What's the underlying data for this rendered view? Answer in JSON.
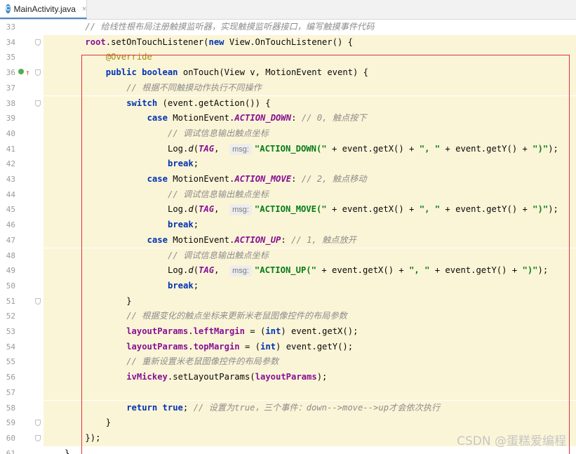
{
  "tab": {
    "icon": "class-icon",
    "icon_letter": "C",
    "label": "MainActivity.java",
    "close": "×"
  },
  "watermark": "CSDN @蛋糕爱编程",
  "lines": [
    {
      "n": "33",
      "indent": 4,
      "segs": [
        {
          "c": "cm",
          "t": "// 给线性根布局注册触摸监听器，实现触摸监听器接口，编写触摸事件代码"
        }
      ]
    },
    {
      "n": "34",
      "indent": 4,
      "segs": [
        {
          "c": "fld",
          "t": "root"
        },
        {
          "c": "",
          "t": ".setOnTouchListener("
        },
        {
          "c": "kw",
          "t": "new"
        },
        {
          "c": "",
          "t": " View.OnTouchListener() {"
        }
      ]
    },
    {
      "n": "35",
      "indent": 8,
      "segs": [
        {
          "c": "an",
          "t": "@Override"
        }
      ]
    },
    {
      "n": "36",
      "indent": 8,
      "segs": [
        {
          "c": "kw",
          "t": "public boolean"
        },
        {
          "c": "",
          "t": " onTouch(View v, MotionEvent event) {"
        }
      ]
    },
    {
      "n": "37",
      "indent": 12,
      "segs": [
        {
          "c": "cm",
          "t": "// 根据不同触摸动作执行不同操作"
        }
      ]
    },
    {
      "n": "38",
      "indent": 12,
      "segs": [
        {
          "c": "kw",
          "t": "switch"
        },
        {
          "c": "",
          "t": " (event.getAction()) {"
        }
      ]
    },
    {
      "n": "39",
      "indent": 16,
      "segs": [
        {
          "c": "kw",
          "t": "case"
        },
        {
          "c": "",
          "t": " MotionEvent."
        },
        {
          "c": "sfld",
          "t": "ACTION_DOWN"
        },
        {
          "c": "",
          "t": ": "
        },
        {
          "c": "cm",
          "t": "// 0, 触点按下"
        }
      ]
    },
    {
      "n": "40",
      "indent": 20,
      "segs": [
        {
          "c": "cm",
          "t": "// 调试信息输出触点坐标"
        }
      ]
    },
    {
      "n": "41",
      "indent": 20,
      "segs": [
        {
          "c": "",
          "t": "Log."
        },
        {
          "c": "mth",
          "t": "d"
        },
        {
          "c": "",
          "t": "("
        },
        {
          "c": "sfld",
          "t": "TAG"
        },
        {
          "c": "",
          "t": ",  "
        },
        {
          "c": "hint",
          "t": "msg:"
        },
        {
          "c": "st",
          "t": "\"ACTION_DOWN(\""
        },
        {
          "c": "",
          "t": " + event.getX() + "
        },
        {
          "c": "st",
          "t": "\", \""
        },
        {
          "c": "",
          "t": " + event.getY() + "
        },
        {
          "c": "st",
          "t": "\")\""
        },
        {
          "c": "",
          "t": ");"
        }
      ]
    },
    {
      "n": "42",
      "indent": 20,
      "segs": [
        {
          "c": "kw",
          "t": "break"
        },
        {
          "c": "",
          "t": ";"
        }
      ]
    },
    {
      "n": "43",
      "indent": 16,
      "segs": [
        {
          "c": "kw",
          "t": "case"
        },
        {
          "c": "",
          "t": " MotionEvent."
        },
        {
          "c": "sfld",
          "t": "ACTION_MOVE"
        },
        {
          "c": "",
          "t": ": "
        },
        {
          "c": "cm",
          "t": "// 2, 触点移动"
        }
      ]
    },
    {
      "n": "44",
      "indent": 20,
      "segs": [
        {
          "c": "cm",
          "t": "// 调试信息输出触点坐标"
        }
      ]
    },
    {
      "n": "45",
      "indent": 20,
      "segs": [
        {
          "c": "",
          "t": "Log."
        },
        {
          "c": "mth",
          "t": "d"
        },
        {
          "c": "",
          "t": "("
        },
        {
          "c": "sfld",
          "t": "TAG"
        },
        {
          "c": "",
          "t": ",  "
        },
        {
          "c": "hint",
          "t": "msg:"
        },
        {
          "c": "st",
          "t": "\"ACTION_MOVE(\""
        },
        {
          "c": "",
          "t": " + event.getX() + "
        },
        {
          "c": "st",
          "t": "\", \""
        },
        {
          "c": "",
          "t": " + event.getY() + "
        },
        {
          "c": "st",
          "t": "\")\""
        },
        {
          "c": "",
          "t": ");"
        }
      ]
    },
    {
      "n": "46",
      "indent": 20,
      "segs": [
        {
          "c": "kw",
          "t": "break"
        },
        {
          "c": "",
          "t": ";"
        }
      ]
    },
    {
      "n": "47",
      "indent": 16,
      "segs": [
        {
          "c": "kw",
          "t": "case"
        },
        {
          "c": "",
          "t": " MotionEvent."
        },
        {
          "c": "sfld",
          "t": "ACTION_UP"
        },
        {
          "c": "",
          "t": ": "
        },
        {
          "c": "cm",
          "t": "// 1, 触点放开"
        }
      ]
    },
    {
      "n": "48",
      "indent": 20,
      "segs": [
        {
          "c": "cm",
          "t": "// 调试信息输出触点坐标"
        }
      ]
    },
    {
      "n": "49",
      "indent": 20,
      "segs": [
        {
          "c": "",
          "t": "Log."
        },
        {
          "c": "mth",
          "t": "d"
        },
        {
          "c": "",
          "t": "("
        },
        {
          "c": "sfld",
          "t": "TAG"
        },
        {
          "c": "",
          "t": ",  "
        },
        {
          "c": "hint",
          "t": "msg:"
        },
        {
          "c": "st",
          "t": "\"ACTION_UP(\""
        },
        {
          "c": "",
          "t": " + event.getX() + "
        },
        {
          "c": "st",
          "t": "\", \""
        },
        {
          "c": "",
          "t": " + event.getY() + "
        },
        {
          "c": "st",
          "t": "\")\""
        },
        {
          "c": "",
          "t": ");"
        }
      ]
    },
    {
      "n": "50",
      "indent": 20,
      "segs": [
        {
          "c": "kw",
          "t": "break"
        },
        {
          "c": "",
          "t": ";"
        }
      ]
    },
    {
      "n": "51",
      "indent": 12,
      "segs": [
        {
          "c": "",
          "t": "}"
        }
      ]
    },
    {
      "n": "52",
      "indent": 12,
      "segs": [
        {
          "c": "cm",
          "t": "// 根据变化的触点坐标来更新米老鼠图像控件的布局参数"
        }
      ]
    },
    {
      "n": "53",
      "indent": 12,
      "segs": [
        {
          "c": "fld",
          "t": "layoutParams"
        },
        {
          "c": "",
          "t": "."
        },
        {
          "c": "fld",
          "t": "leftMargin"
        },
        {
          "c": "",
          "t": " = ("
        },
        {
          "c": "kw",
          "t": "int"
        },
        {
          "c": "",
          "t": ") event.getX();"
        }
      ]
    },
    {
      "n": "54",
      "indent": 12,
      "segs": [
        {
          "c": "fld",
          "t": "layoutParams"
        },
        {
          "c": "",
          "t": "."
        },
        {
          "c": "fld",
          "t": "topMargin"
        },
        {
          "c": "",
          "t": " = ("
        },
        {
          "c": "kw",
          "t": "int"
        },
        {
          "c": "",
          "t": ") event.getY();"
        }
      ]
    },
    {
      "n": "55",
      "indent": 12,
      "segs": [
        {
          "c": "cm",
          "t": "// 重新设置米老鼠图像控件的布局参数"
        }
      ]
    },
    {
      "n": "56",
      "indent": 12,
      "segs": [
        {
          "c": "fld",
          "t": "ivMickey"
        },
        {
          "c": "",
          "t": ".setLayoutParams("
        },
        {
          "c": "fld",
          "t": "layoutParams"
        },
        {
          "c": "",
          "t": ");"
        }
      ]
    },
    {
      "n": "57",
      "indent": 0,
      "segs": []
    },
    {
      "n": "58",
      "indent": 12,
      "segs": [
        {
          "c": "kw",
          "t": "return true"
        },
        {
          "c": "",
          "t": "; "
        },
        {
          "c": "cm",
          "t": "// 设置为true，三个事件：down-->move-->up才会依次执行"
        }
      ]
    },
    {
      "n": "59",
      "indent": 8,
      "segs": [
        {
          "c": "",
          "t": "}"
        }
      ]
    },
    {
      "n": "60",
      "indent": 4,
      "segs": [
        {
          "c": "",
          "t": "});"
        }
      ]
    },
    {
      "n": "61",
      "indent": 0,
      "segs": [
        {
          "c": "",
          "t": "}"
        }
      ]
    }
  ]
}
